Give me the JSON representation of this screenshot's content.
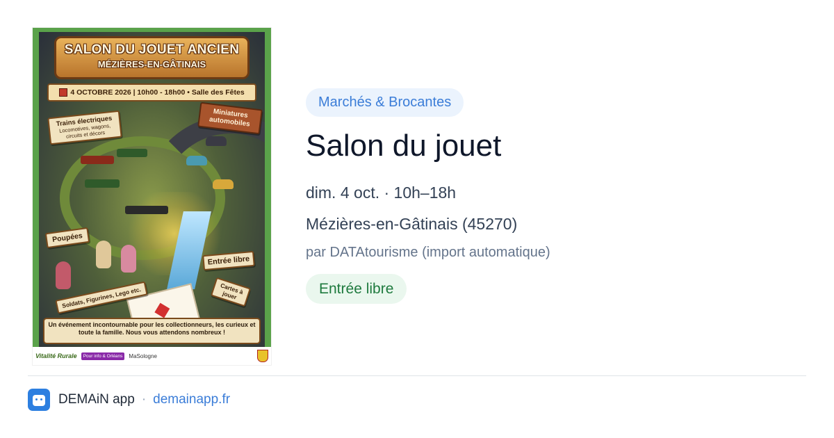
{
  "poster": {
    "title": "SALON DU JOUET ANCIEN",
    "town": "MÉZIÈRES-EN-GÂTINAIS",
    "dateline": "4 OCTOBRE 2026 | 10h00 - 18h00 • Salle des Fêtes",
    "sign_trains_title": "Trains électriques",
    "sign_trains_detail": "Locomotives, wagons, circuits et décors",
    "sign_miniatures": "Miniatures automobiles",
    "sign_poupees": "Poupées",
    "sign_entree": "Entrée libre",
    "sign_cartes": "Cartes à jouer",
    "sign_soldats": "Soldats, Figurines, Lego etc.",
    "footer_text": "Un événement incontournable pour les collectionneurs, les curieux et toute la famille. Nous vous attendons nombreux !",
    "brand": "Vitalité Rurale",
    "badge": "Pour info & Orléans",
    "handle": "MaSologne"
  },
  "event": {
    "category": "Marchés & Brocantes",
    "title": "Salon du jouet",
    "date": "dim. 4 oct. · 10h–18h",
    "location": "Mézières-en-Gâtinais (45270)",
    "organizer": "par DATAtourisme (import automatique)",
    "price": "Entrée libre"
  },
  "footer": {
    "app_name": "DEMAiN app",
    "separator": "·",
    "url": "demainapp.fr"
  },
  "colors": {
    "accent_blue": "#3b7dd8",
    "category_bg": "#ebf3fd",
    "price_green": "#1e7a3e",
    "price_bg": "#eaf7ee",
    "poster_frame": "#5aa24a"
  },
  "icons": {
    "app_icon": "demain-app-icon"
  }
}
